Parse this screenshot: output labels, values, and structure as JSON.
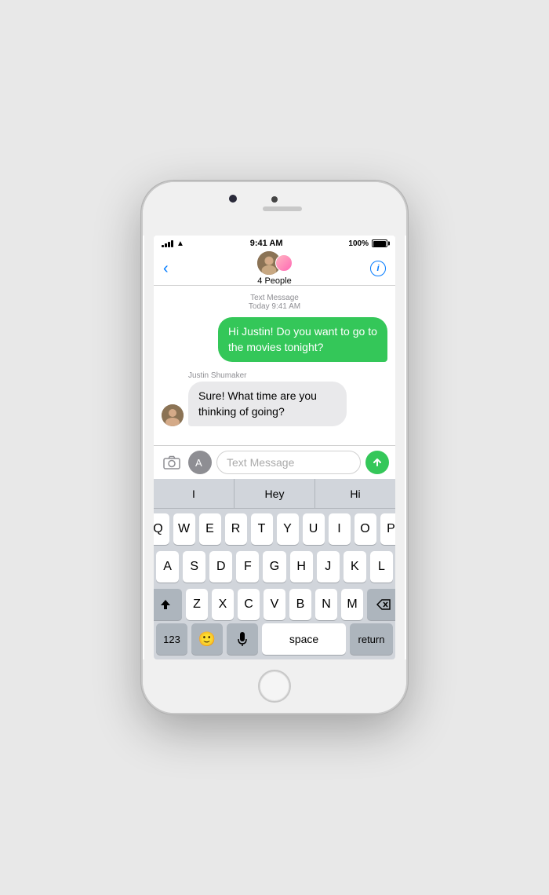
{
  "phone": {
    "status": {
      "time": "9:41 AM",
      "battery": "100%"
    },
    "nav": {
      "back_label": "",
      "title": "4 People",
      "info_label": "i"
    },
    "messages": {
      "meta_type": "Text Message",
      "meta_time": "Today 9:41 AM",
      "outgoing": "Hi Justin! Do you want to go to the movies tonight?",
      "sender_name": "Justin Shumaker",
      "incoming": "Sure! What time are you thinking of going?"
    },
    "input": {
      "placeholder": "Text Message"
    },
    "keyboard": {
      "autocomplete": [
        "I",
        "Hey",
        "Hi"
      ],
      "row1": [
        "Q",
        "W",
        "E",
        "R",
        "T",
        "Y",
        "U",
        "I",
        "O",
        "P"
      ],
      "row2": [
        "A",
        "S",
        "D",
        "F",
        "G",
        "H",
        "J",
        "K",
        "L"
      ],
      "row3": [
        "Z",
        "X",
        "C",
        "V",
        "B",
        "N",
        "M"
      ],
      "bottom": {
        "num": "123",
        "space": "space",
        "return": "return"
      }
    }
  }
}
